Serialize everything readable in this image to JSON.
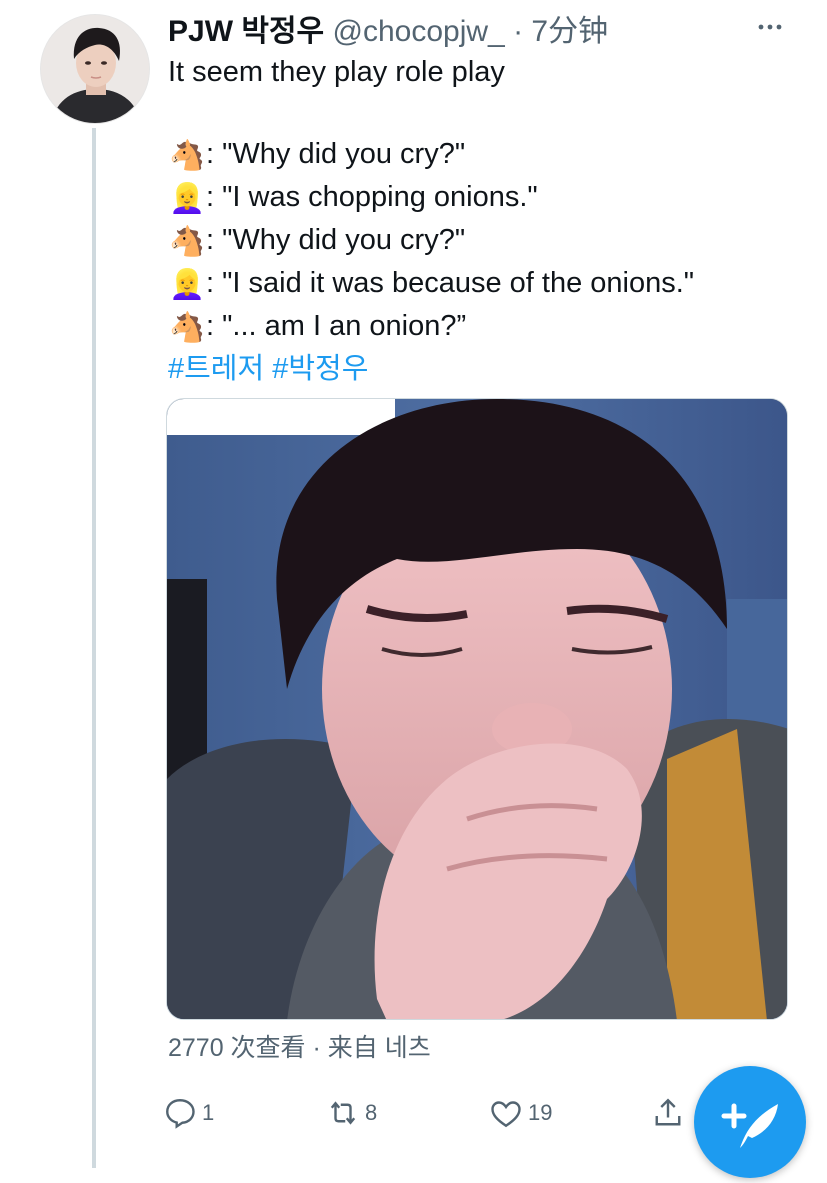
{
  "tweet": {
    "display_name": "PJW 박정우",
    "handle": "@chocopjw_",
    "separator": "·",
    "time": "7分钟",
    "lines": [
      {
        "emoji": "",
        "text": "It seem they play role play"
      },
      {
        "emoji": "",
        "text": ""
      },
      {
        "emoji": "🐴",
        "text": ": \"Why did you cry?\""
      },
      {
        "emoji": "👱‍♀️",
        "text": ": \"I was chopping onions.\""
      },
      {
        "emoji": "🐴",
        "text": ": \"Why did you cry?\""
      },
      {
        "emoji": "👱‍♀️",
        "text": ": \"I said it was because of the onions.\""
      },
      {
        "emoji": "🐴",
        "text": ": \"... am I an onion?”"
      }
    ],
    "hashtags": "#트레저 #박정우",
    "views": "2770 次查看 · 来自 네츠"
  },
  "actions": {
    "reply_count": "1",
    "retweet_count": "8",
    "like_count": "19"
  },
  "icons": {
    "more": "more-horizontal-icon",
    "reply": "reply-icon",
    "retweet": "retweet-icon",
    "like": "heart-icon",
    "share": "share-icon",
    "compose": "compose-tweet-icon"
  },
  "colors": {
    "accent": "#1d9bf0",
    "secondary_text": "#536471",
    "thread_line": "#cfd9de"
  }
}
